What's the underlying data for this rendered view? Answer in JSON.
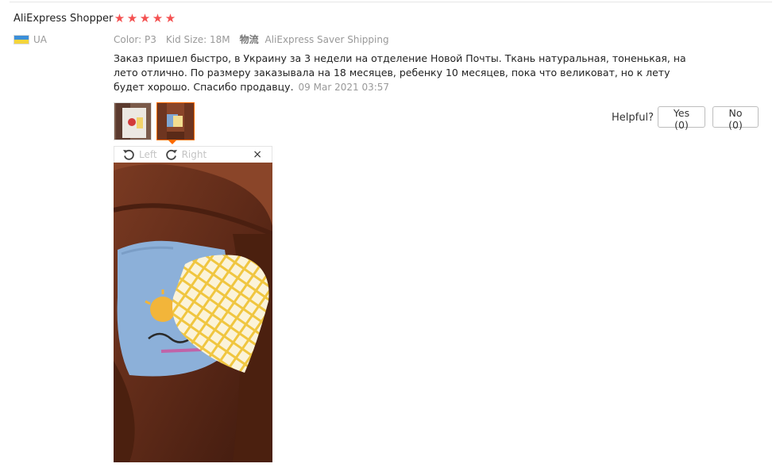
{
  "reviewer": {
    "name": "AliExpress Shopper",
    "country_code": "UA",
    "rating": 5,
    "star_glyph": "★"
  },
  "meta": {
    "color_label": "Color:",
    "color_value": "P3",
    "size_label": "Kid Size:",
    "size_value": "18M",
    "shipping_cn": "物流",
    "shipping_value": "AliExpress Saver Shipping"
  },
  "review": {
    "text": "Заказ пришел быстро, в Украину за 3 недели на отделение Новой Почты. Ткань натуральная, тоненькая, на лето отлично. По размеру заказывала на 18 месяцев, ребенку 10 месяцев, пока что великоват, но к лету будет хорошо. Спасибо продавцу.",
    "date": "09 Mar 2021 03:57"
  },
  "helpful": {
    "label": "Helpful?",
    "yes_label": "Yes (0)",
    "no_label": "No (0)"
  },
  "viewer": {
    "rotate_left_label": "Left",
    "rotate_right_label": "Right",
    "close_glyph": "×"
  },
  "colors": {
    "star": "#f45151",
    "active_border": "#ff6a00",
    "flag_blue": "#3b8fd9",
    "flag_yellow": "#f5d53b"
  }
}
